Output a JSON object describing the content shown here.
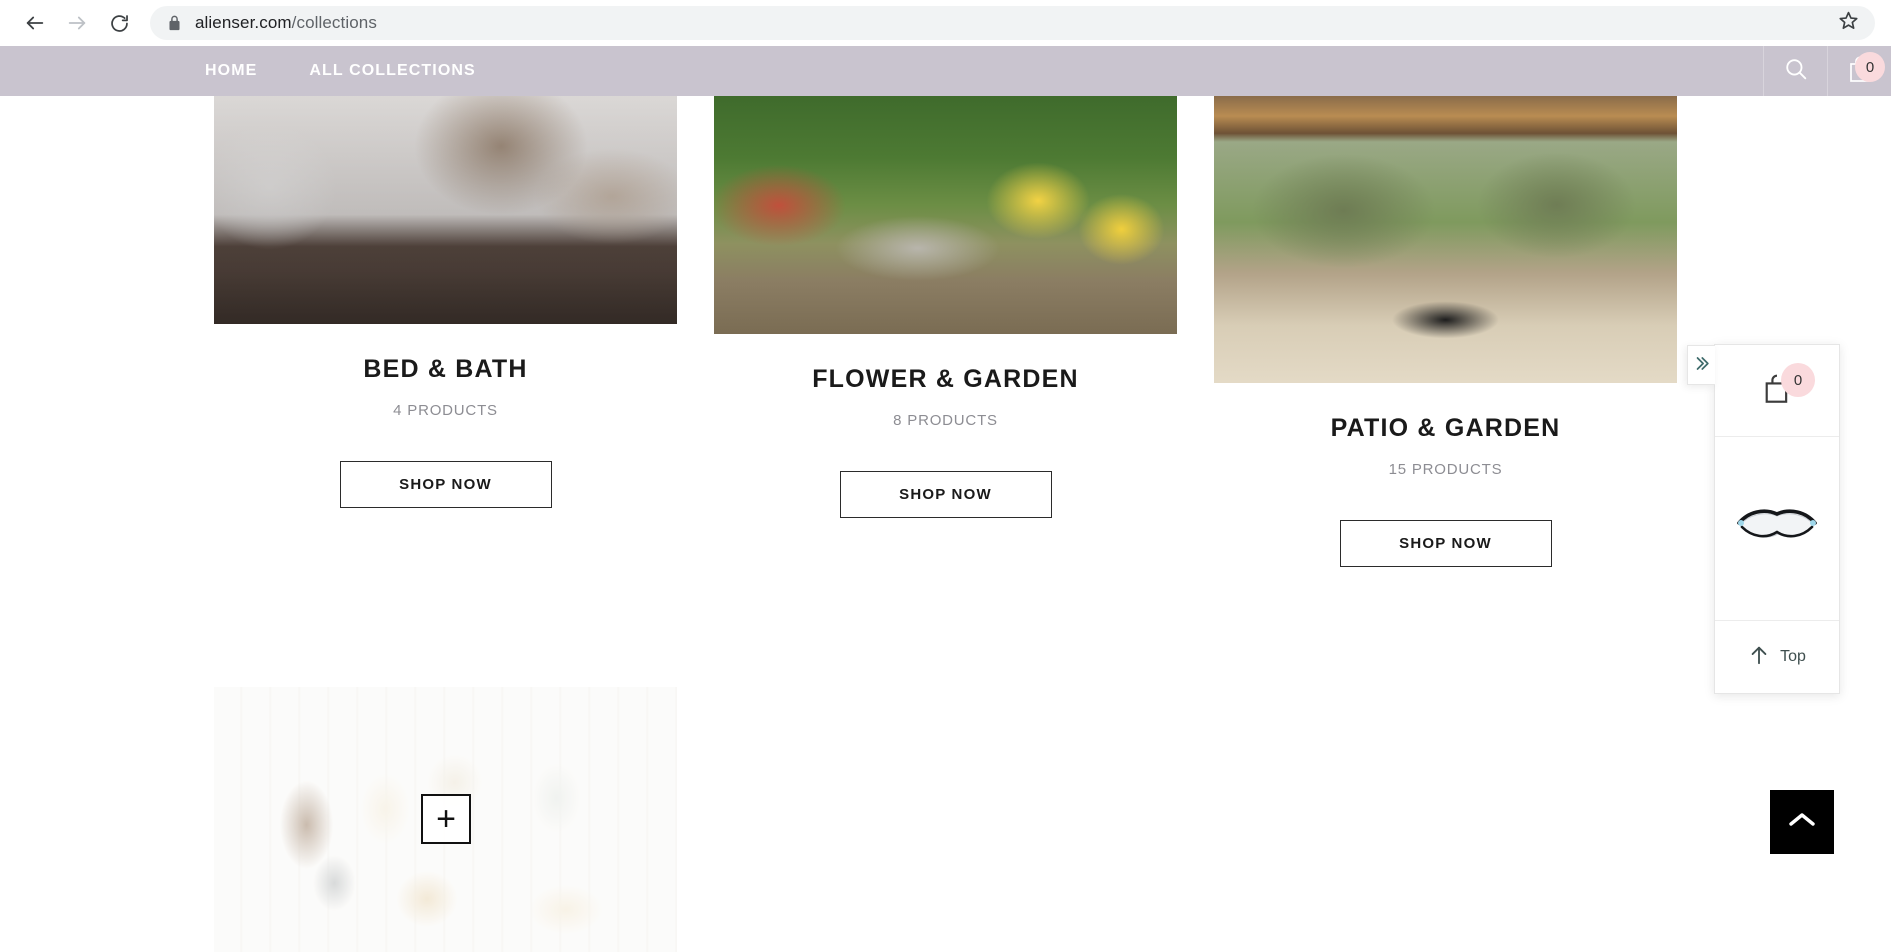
{
  "browser": {
    "back_icon": "back-arrow-icon",
    "forward_icon": "forward-arrow-icon",
    "reload_icon": "reload-icon",
    "lock_icon": "lock-icon",
    "url_domain": "alienser.com",
    "url_path": "/collections",
    "bookmark_icon": "star-icon"
  },
  "site_nav": {
    "links": [
      {
        "label": "HOME"
      },
      {
        "label": "ALL COLLECTIONS"
      }
    ],
    "search_icon": "search-icon",
    "cart_icon": "shopping-bag-icon",
    "cart_count": "0",
    "background_color": "#c9c4cf",
    "badge_color": "#fadadd"
  },
  "collections": [
    {
      "title": "BED & BATH",
      "count": "4 PRODUCTS",
      "shop_label": "SHOP NOW",
      "image_alt": "bathroom-interior-image"
    },
    {
      "title": "FLOWER & GARDEN",
      "count": "8 PRODUCTS",
      "shop_label": "SHOP NOW",
      "image_alt": "garden-deck-image"
    },
    {
      "title": "PATIO & GARDEN",
      "count": "15 PRODUCTS",
      "shop_label": "SHOP NOW",
      "image_alt": "patio-pergola-image"
    },
    {
      "title": "",
      "count": "",
      "shop_label": "",
      "image_alt": "bath-products-flatlay-image",
      "quick_add_label": "+"
    }
  ],
  "side_widget": {
    "collapse_icon": "chevron-double-right-icon",
    "cart_icon": "shopping-bag-icon",
    "cart_count": "0",
    "product_thumb_alt": "magnifying-glasses-thumbnail",
    "top_icon": "arrow-up-icon",
    "top_label": "Top",
    "accent_color": "#3f6b6b"
  },
  "scroll_top": {
    "icon": "chevron-up-icon",
    "background_color": "#000000"
  }
}
